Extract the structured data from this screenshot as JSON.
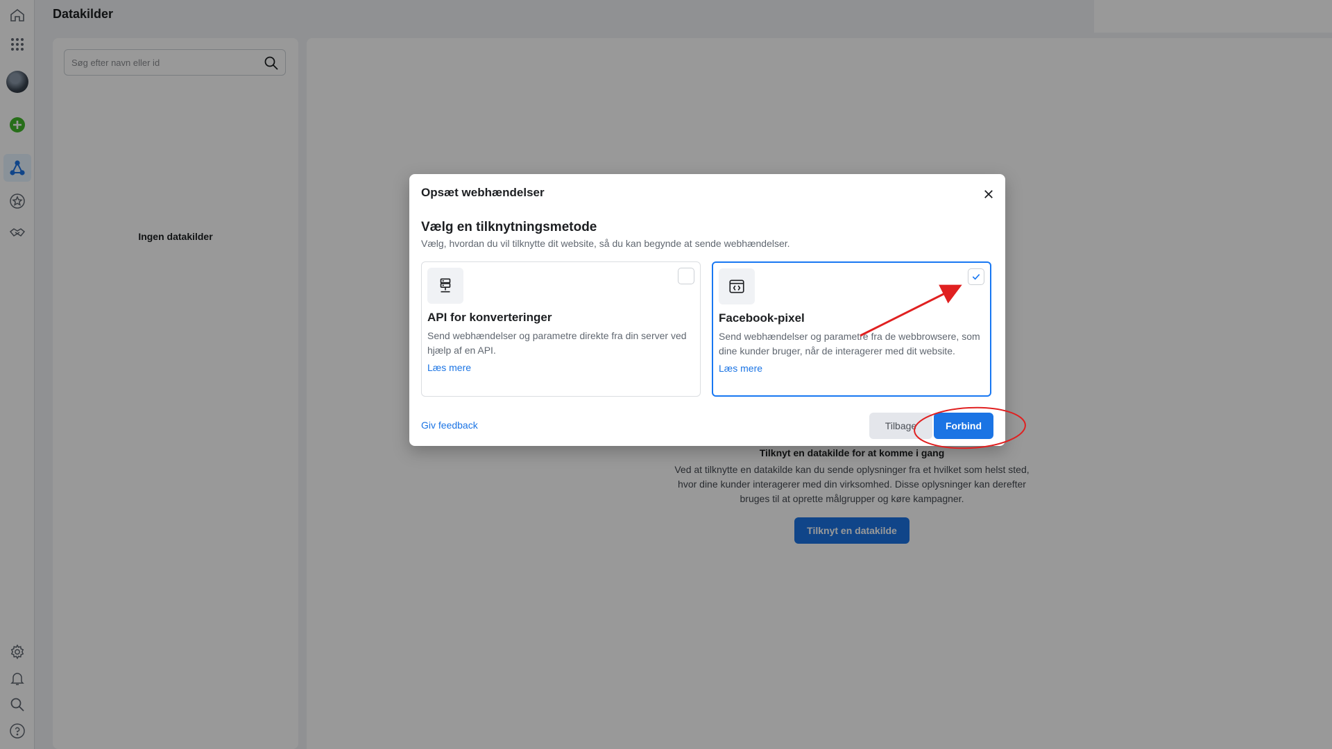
{
  "header": {
    "title": "Datakilder"
  },
  "rail": {
    "icons": [
      "home-icon",
      "apps-grid-icon",
      "avatar",
      "add-icon",
      "data-sources-icon",
      "star-badge-icon",
      "partners-icon",
      "settings-icon",
      "bell-icon",
      "search-icon",
      "help-icon"
    ]
  },
  "side_panel": {
    "search_placeholder": "Søg efter navn eller id",
    "empty_text": "Ingen datakilder"
  },
  "main": {
    "empty_title": "Tilknyt en datakilde for at komme i gang",
    "empty_desc": "Ved at tilknytte en datakilde kan du sende oplysninger fra et hvilket som helst sted, hvor dine kunder interagerer med din virksomhed. Disse oplysninger kan derefter bruges til at oprette målgrupper og køre kampagner.",
    "connect_button": "Tilknyt en datakilde"
  },
  "modal": {
    "title": "Opsæt webhændelser",
    "heading": "Vælg en tilknytningsmetode",
    "subheading": "Vælg, hvordan du vil tilknytte dit website, så du kan begynde at sende webhændelser.",
    "options": [
      {
        "title": "API for konverteringer",
        "description": "Send webhændelser og parametre direkte fra din server ved hjælp af en API.",
        "link": "Læs mere",
        "selected": false
      },
      {
        "title": "Facebook-pixel",
        "description": "Send webhændelser og parametre fra de webbrowsere, som dine kunder bruger, når de interagerer med dit website.",
        "link": "Læs mere",
        "selected": true
      }
    ],
    "feedback_link": "Giv feedback",
    "back_button": "Tilbage",
    "connect_button": "Forbind"
  },
  "colors": {
    "accent": "#1b74e4",
    "selected_border": "#1877f2",
    "annotation": "#e02020",
    "add_icon": "#42b72a"
  }
}
